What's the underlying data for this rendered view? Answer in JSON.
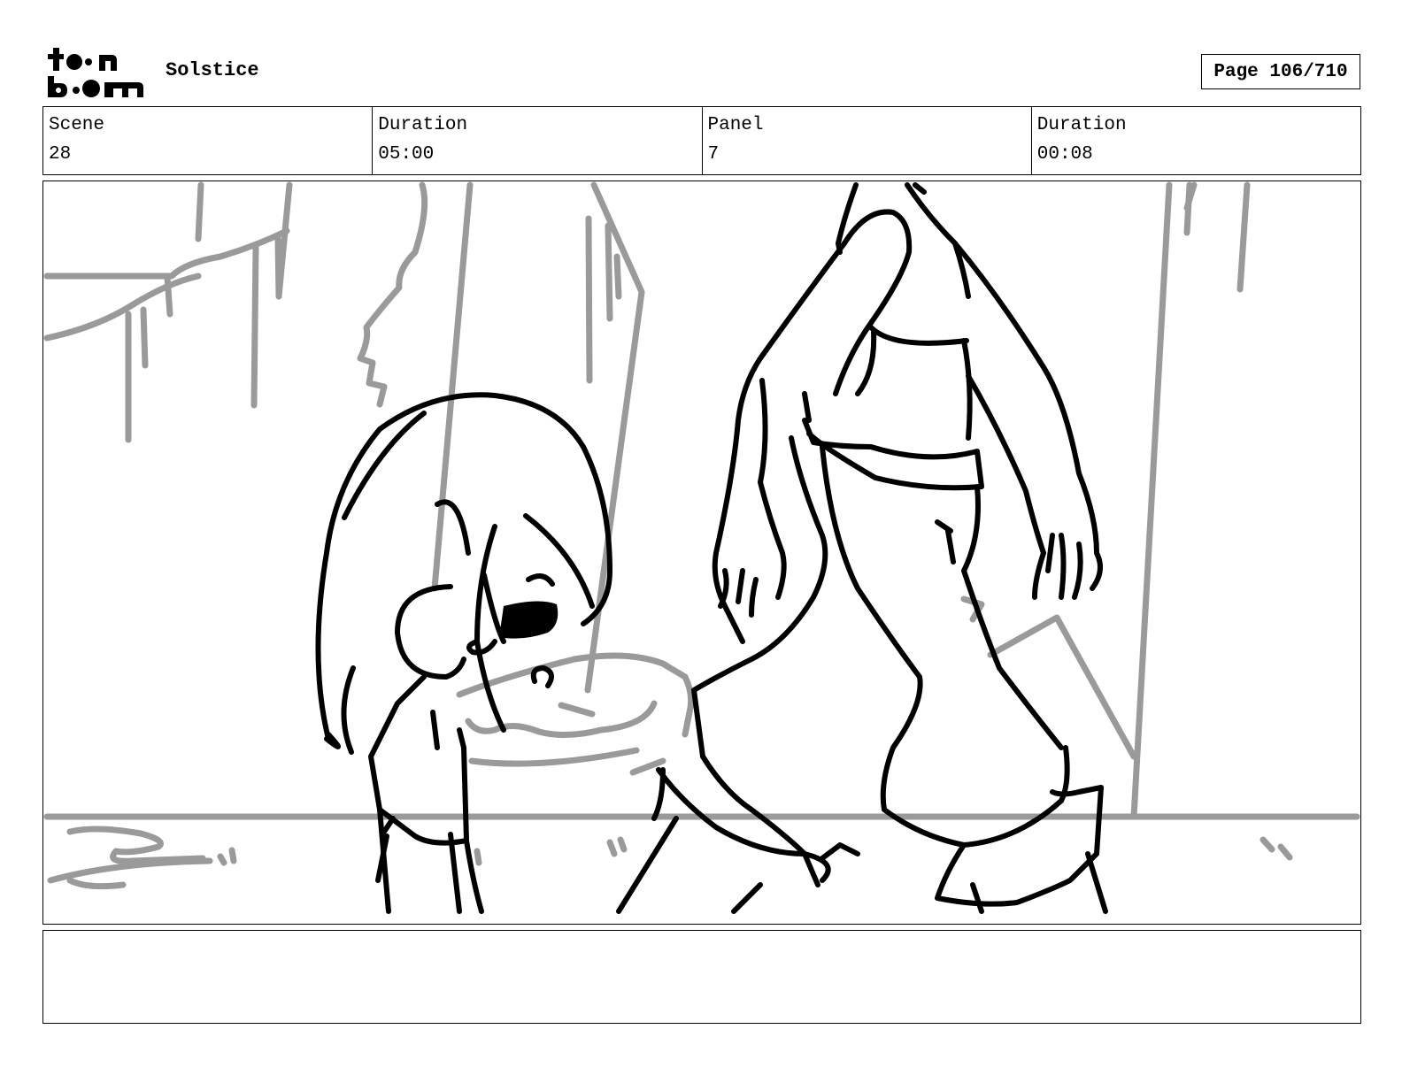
{
  "header": {
    "logo_text": "toon boom",
    "project_title": "Solstice",
    "page_label": "Page 106/710"
  },
  "info": {
    "scene_label": "Scene",
    "scene_value": "28",
    "scene_duration_label": "Duration",
    "scene_duration_value": "05:00",
    "panel_label": "Panel",
    "panel_value": "7",
    "panel_duration_label": "Duration",
    "panel_duration_value": "00:08"
  },
  "notes": {
    "text": ""
  },
  "colors": {
    "ink": "#000000",
    "background_sketch": "#9a9a9a"
  }
}
